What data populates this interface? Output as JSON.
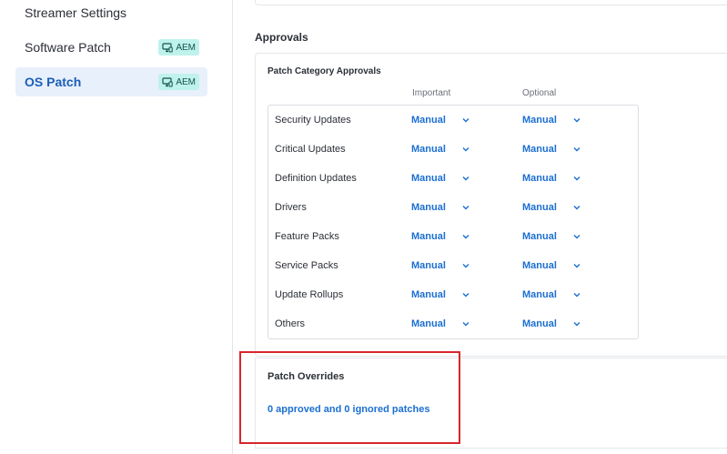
{
  "sidebar": {
    "items": [
      {
        "label": "Streamer Settings"
      },
      {
        "label": "Software Patch",
        "badge": "AEM"
      },
      {
        "label": "OS Patch",
        "badge": "AEM",
        "active": true
      }
    ]
  },
  "approvals": {
    "section_title": "Approvals",
    "card_title": "Patch Category Approvals",
    "columns": {
      "important": "Important",
      "optional": "Optional"
    },
    "rows": [
      {
        "label": "Security Updates",
        "important": "Manual",
        "optional": "Manual"
      },
      {
        "label": "Critical Updates",
        "important": "Manual",
        "optional": "Manual"
      },
      {
        "label": "Definition Updates",
        "important": "Manual",
        "optional": "Manual"
      },
      {
        "label": "Drivers",
        "important": "Manual",
        "optional": "Manual"
      },
      {
        "label": "Feature Packs",
        "important": "Manual",
        "optional": "Manual"
      },
      {
        "label": "Service Packs",
        "important": "Manual",
        "optional": "Manual"
      },
      {
        "label": "Update Rollups",
        "important": "Manual",
        "optional": "Manual"
      },
      {
        "label": "Others",
        "important": "Manual",
        "optional": "Manual"
      }
    ]
  },
  "overrides": {
    "title": "Patch Overrides",
    "link": "0 approved and 0 ignored patches"
  },
  "colors": {
    "accent": "#1b6fd1",
    "active_bg": "#e8f0fb",
    "badge_bg": "#bff2ec",
    "highlight": "#d8252d"
  },
  "icons": {
    "badge": "monitor-icon",
    "dropdown": "chevron-down-icon"
  }
}
